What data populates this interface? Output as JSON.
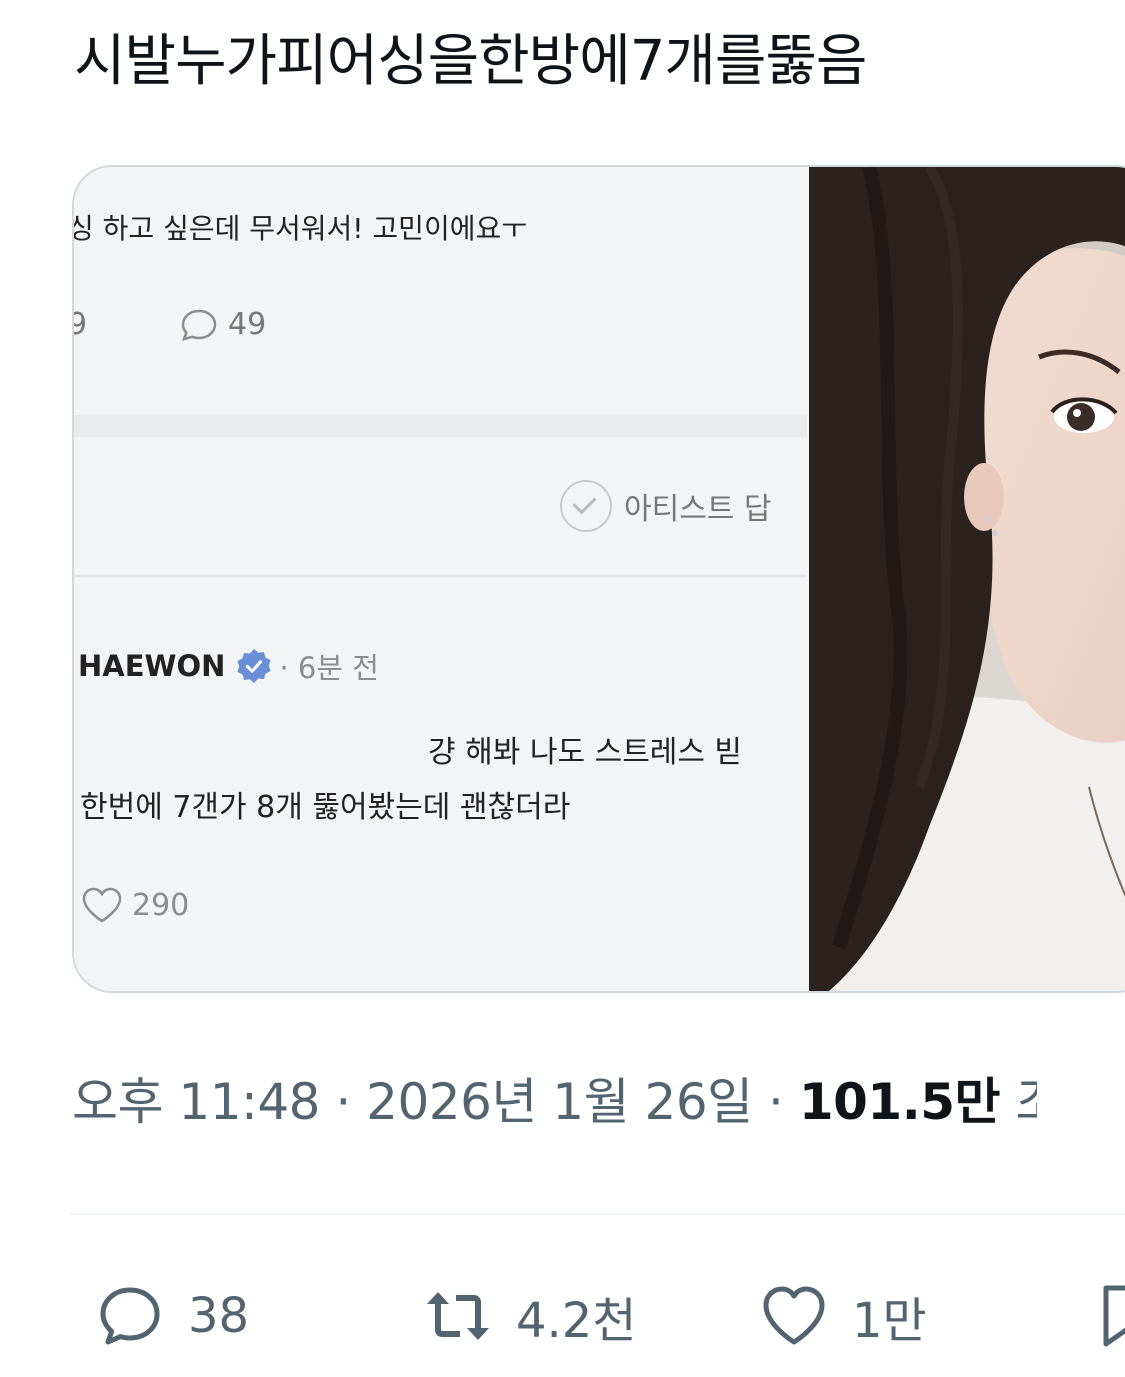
{
  "tweet": {
    "text": "시발누가피어싱을한방에7개를뚫음"
  },
  "media_screenshot": {
    "question_text": "싱 하고 싶은데 무서워서! 고민이에요ㅜ",
    "question_stats_cut": "9",
    "question_comment_count": "49",
    "artist_tag": "아티스트 답",
    "author_name": "HAEWON",
    "author_meta": "· 6분 전",
    "reply_line1": "걍 해봐 나도 스트레스 빋",
    "reply_line2": "한번에 7갠가 8개 뚫어봤는데 괜찮더라",
    "like_count": "290"
  },
  "meta": {
    "time_date": "오후 11:48 · 2026년 1월 26일 · ",
    "views": "101.5만",
    "views_cut": "조"
  },
  "actions": {
    "replies": "38",
    "retweets": "4.2천",
    "likes": "1만"
  },
  "colors": {
    "text_primary": "#0f1419",
    "text_secondary": "#536471",
    "verified_badge": "#6b8fd6"
  }
}
